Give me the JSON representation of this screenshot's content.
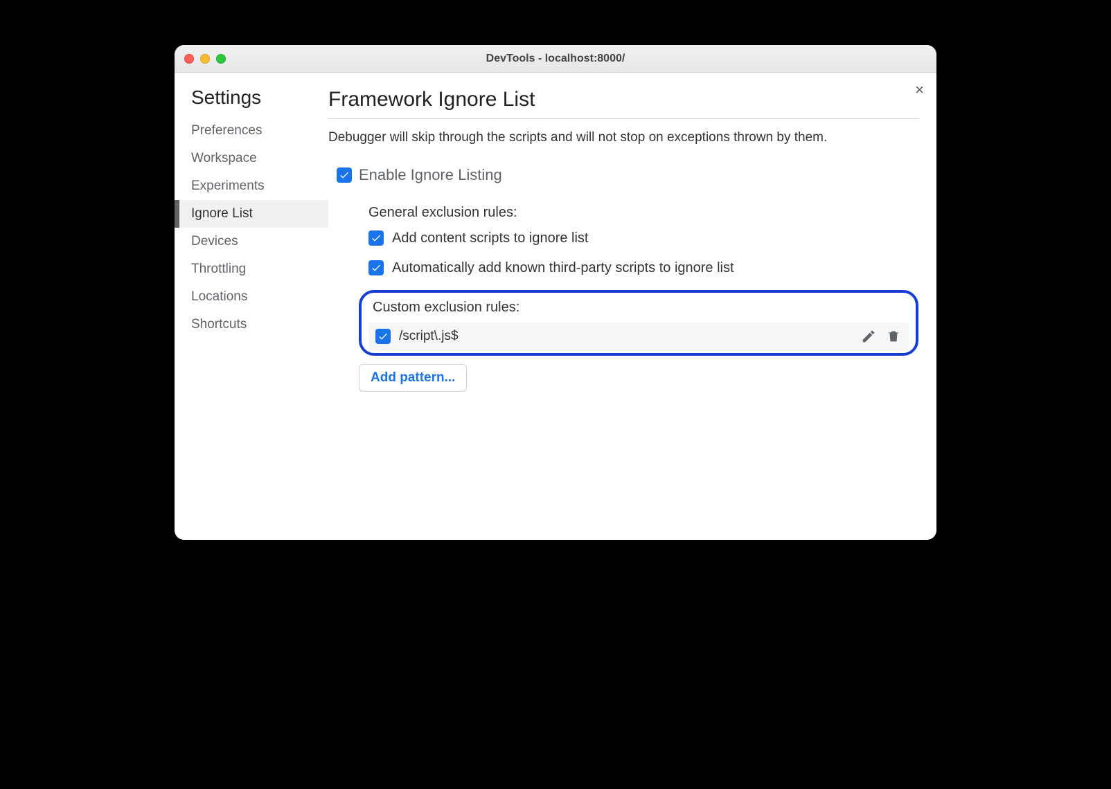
{
  "window_title": "DevTools - localhost:8000/",
  "close_label": "×",
  "sidebar": {
    "title": "Settings",
    "items": [
      {
        "label": "Preferences"
      },
      {
        "label": "Workspace"
      },
      {
        "label": "Experiments"
      },
      {
        "label": "Ignore List"
      },
      {
        "label": "Devices"
      },
      {
        "label": "Throttling"
      },
      {
        "label": "Locations"
      },
      {
        "label": "Shortcuts"
      }
    ],
    "selected_index": 3
  },
  "page": {
    "title": "Framework Ignore List",
    "description": "Debugger will skip through the scripts and will not stop on exceptions thrown by them.",
    "enable_label": "Enable Ignore Listing",
    "enable_checked": true,
    "general_title": "General exclusion rules:",
    "general_rules": [
      {
        "label": "Add content scripts to ignore list",
        "checked": true
      },
      {
        "label": "Automatically add known third-party scripts to ignore list",
        "checked": true
      }
    ],
    "custom_title": "Custom exclusion rules:",
    "custom_rules": [
      {
        "pattern": "/script\\.js$",
        "checked": true
      }
    ],
    "add_pattern_label": "Add pattern..."
  }
}
